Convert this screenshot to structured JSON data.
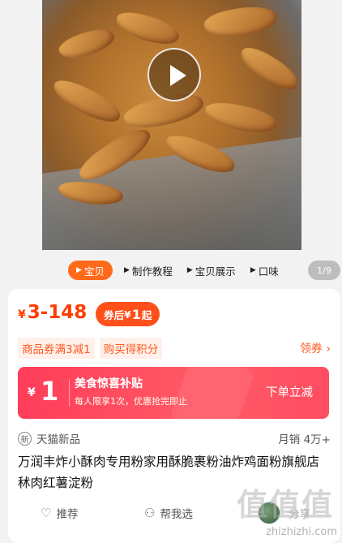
{
  "media_tabs": {
    "items": [
      {
        "label": "宝贝",
        "active": true
      },
      {
        "label": "制作教程",
        "active": false
      },
      {
        "label": "宝贝展示",
        "active": false
      },
      {
        "label": "口味",
        "active": false
      }
    ],
    "counter": "1/9"
  },
  "price": {
    "currency": "¥",
    "range": "3-148",
    "coupon_prefix": "券后",
    "coupon_currency": "¥",
    "coupon_amount": "1",
    "coupon_suffix": "起"
  },
  "promos": {
    "items": [
      "商品券满3减1",
      "购买得积分"
    ],
    "get_coupon": "领券 ›"
  },
  "subsidy": {
    "currency": "¥",
    "amount": "1",
    "title": "美食惊喜补贴",
    "desc": "每人限享1次，优惠抢完即止",
    "cta": "下单立减"
  },
  "shop": {
    "new_icon": "新",
    "tag": "天猫新品",
    "sales": "月销 4万+"
  },
  "product": {
    "title": "万润丰炸小酥肉专用粉家用酥脆裹粉油炸鸡面粉旗舰店秫肉红薯淀粉"
  },
  "actions": {
    "recommend": "推荐",
    "help_choose": "帮我选",
    "share": "分享"
  },
  "watermark": {
    "text": "值值值",
    "url": "zhizhizhi.com"
  },
  "colors": {
    "accent": "#ff3c00",
    "subsidy": "#ff4d62",
    "tab_active": "#ff6a1a"
  }
}
